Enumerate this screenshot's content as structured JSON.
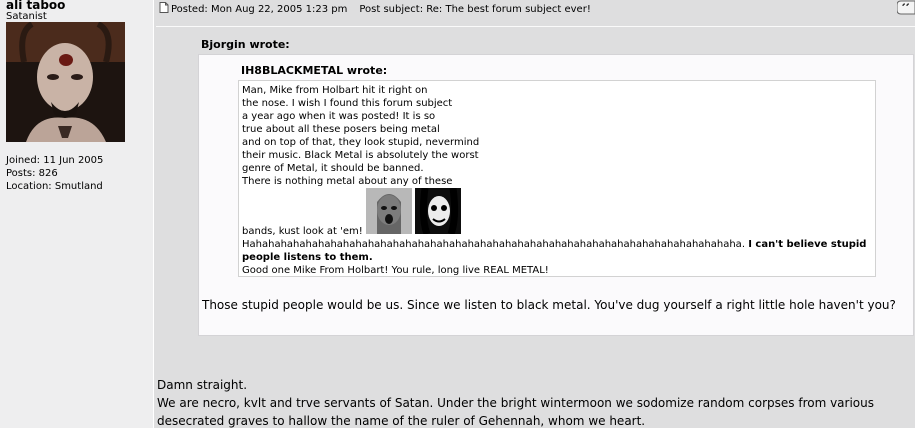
{
  "user": {
    "name": "ali taboo",
    "rank": "Satanist",
    "joined": "Joined: 11 Jun 2005",
    "posts": "Posts: 826",
    "location": "Location: Smutland"
  },
  "post": {
    "posted": "Posted: Mon Aug 22, 2005 1:23 pm",
    "subject": "Post subject: Re: The best forum subject ever!",
    "outer_quote": {
      "author": "Bjorgin wrote:",
      "inner_quote": {
        "author": "IH8BLACKMETAL wrote:",
        "lines": [
          "Man, Mike from Holbart hit it right on",
          "the nose. I wish I found this forum subject",
          "a year ago when it was posted! It is so",
          "true about all these posers being metal",
          "and on top of that, they look stupid, nevermind",
          "their music. Black Metal is absolutely the worst",
          "genre of Metal, it should be banned.",
          "There is nothing metal about any of these"
        ],
        "bands_text": "bands, kust look at 'em!",
        "laugh": "Hahahahahahahahahahahahahahahahahahahahahahahahahahahahahahahahahahahahahahahaha.",
        "bold": "I can't believe stupid people listens to them.",
        "closing": "Good one Mike From Holbart! You rule, long live REAL METAL!"
      },
      "reply": "Those stupid people would be us. Since we listen to black metal. You've dug yourself a right little hole haven't you?"
    },
    "body": [
      "Damn straight.",
      "We are necro, kvlt and trve servants of Satan. Under the bright wintermoon we sodomize random corpses from various",
      "desecrated graves to hallow the name of the ruler of Gehennah, whom we heart."
    ]
  },
  "icons": [
    "post-doc-icon",
    "quote-button-icon"
  ]
}
